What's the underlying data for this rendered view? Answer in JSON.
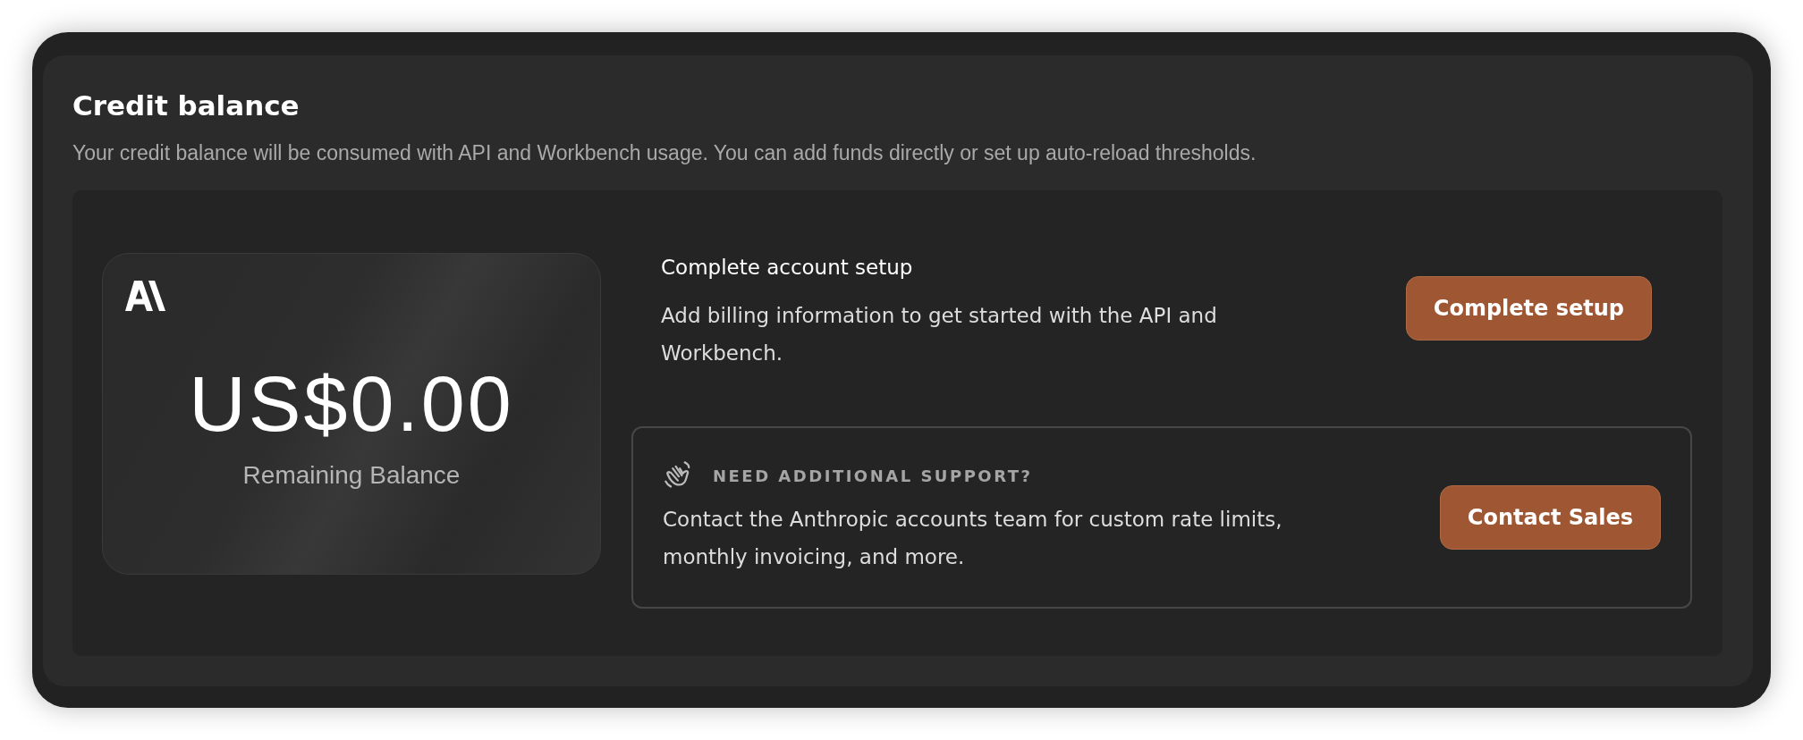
{
  "section": {
    "title": "Credit balance",
    "description": "Your credit balance will be consumed with API and Workbench usage. You can add funds directly or set up auto-reload thresholds."
  },
  "balance_card": {
    "amount": "US$0.00",
    "label": "Remaining Balance"
  },
  "setup": {
    "title": "Complete account setup",
    "description": "Add billing information to get started with the API and Workbench.",
    "button": "Complete setup"
  },
  "support": {
    "heading": "NEED ADDITIONAL SUPPORT?",
    "description": "Contact the Anthropic accounts team for custom rate limits, monthly invoicing, and more.",
    "button": "Contact Sales"
  }
}
